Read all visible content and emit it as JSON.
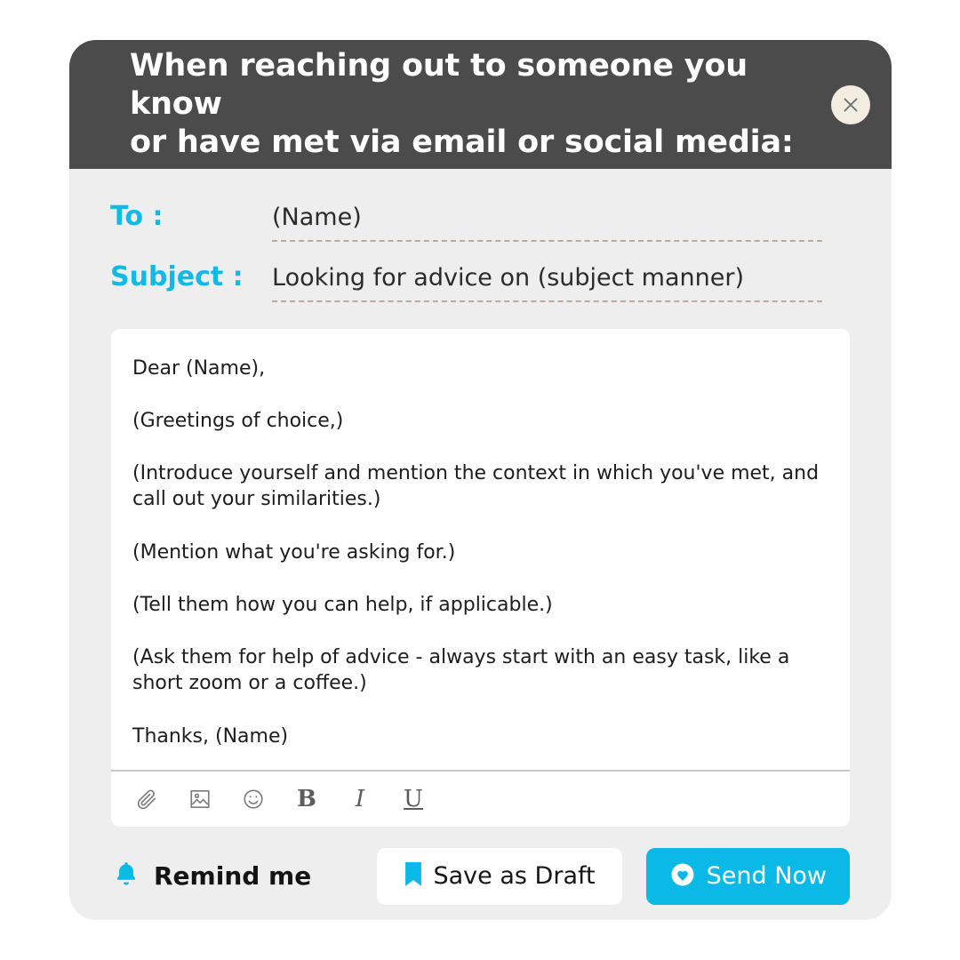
{
  "header": {
    "title": "When reaching out to someone you know\nor have met via email or social media:",
    "close_icon": "close-icon"
  },
  "colors": {
    "accent": "#0ab9e6",
    "header_bg": "#4b4b4b",
    "card_bg": "#eeeeee",
    "close_btn_bg": "#f2ece1",
    "dashed_underline": "#c2a79c"
  },
  "fields": {
    "to": {
      "label": "To :",
      "value": "(Name)"
    },
    "subject": {
      "label": "Subject :",
      "value": "Looking for advice on (subject manner)"
    }
  },
  "editor": {
    "paragraphs": [
      "Dear (Name),",
      "(Greetings of choice,)",
      "(Introduce yourself and mention the context in which you've met, and call out your similarities.)",
      "(Mention what you're asking for.)",
      "(Tell them how you can help, if applicable.)",
      "(Ask them for help of advice - always start with an easy task, like a short zoom or a coffee.)",
      "Thanks, (Name)"
    ],
    "toolbar": [
      {
        "name": "attachment-icon",
        "label": ""
      },
      {
        "name": "image-icon",
        "label": ""
      },
      {
        "name": "emoji-icon",
        "label": ""
      },
      {
        "name": "bold-icon",
        "label": "B"
      },
      {
        "name": "italic-icon",
        "label": "I"
      },
      {
        "name": "underline-icon",
        "label": "U"
      }
    ]
  },
  "actions": {
    "remind": {
      "icon": "bell-icon",
      "label": "Remind me"
    },
    "save_draft": {
      "icon": "bookmark-icon",
      "label": "Save as Draft"
    },
    "send": {
      "icon": "heart-circle-icon",
      "label": "Send Now"
    }
  }
}
